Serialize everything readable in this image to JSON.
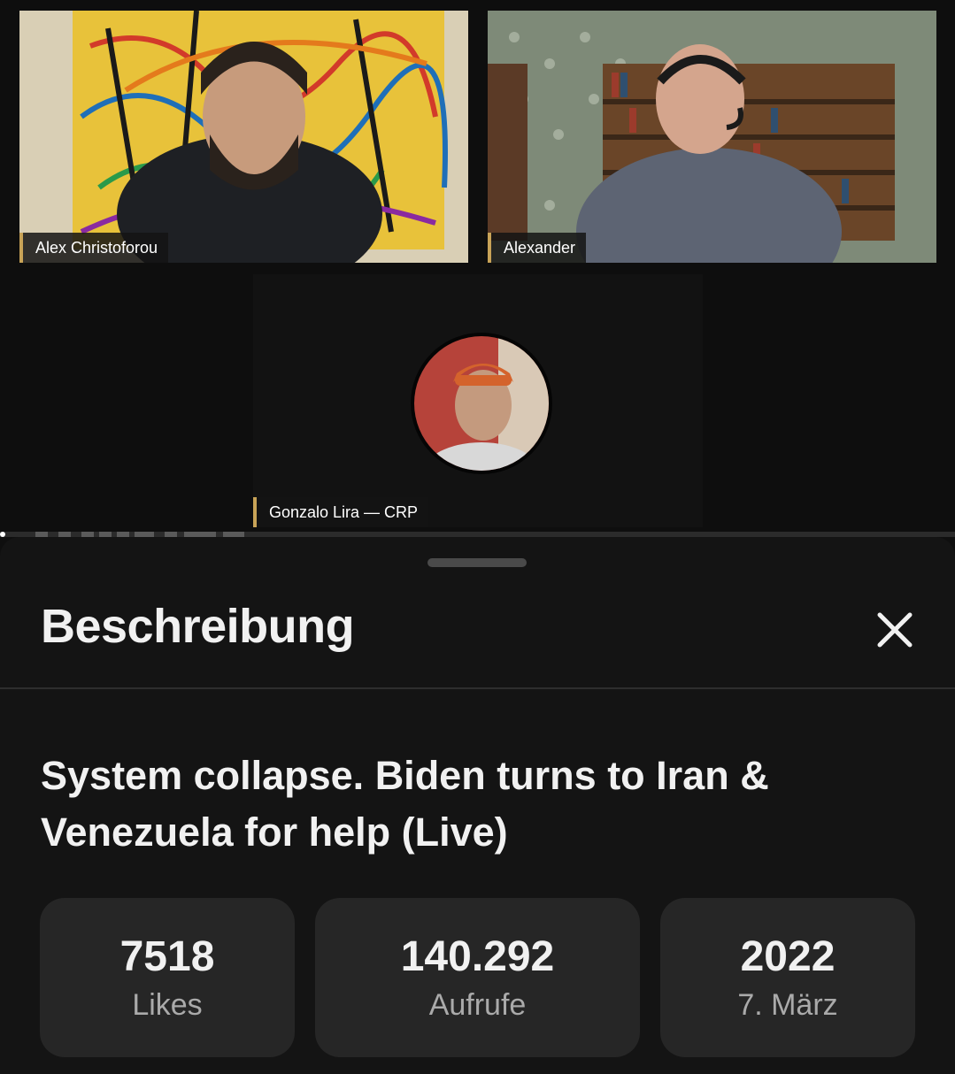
{
  "video": {
    "participants": [
      {
        "name": "Alex Christoforou"
      },
      {
        "name": "Alexander"
      },
      {
        "name": "Gonzalo Lira — CRP"
      }
    ]
  },
  "sheet": {
    "title": "Beschreibung",
    "close_icon": "close-icon",
    "video_title": "System collapse. Biden turns to Iran & Venezuela for help (Live)",
    "stats": [
      {
        "value": "7518",
        "label": "Likes"
      },
      {
        "value": "140.292",
        "label": "Aufrufe"
      },
      {
        "value": "2022",
        "label": "7. März"
      }
    ]
  },
  "colors": {
    "background": "#0f0f0f",
    "sheet": "#141414",
    "stat_card": "#262626",
    "nametag_accent": "#c8a357"
  }
}
